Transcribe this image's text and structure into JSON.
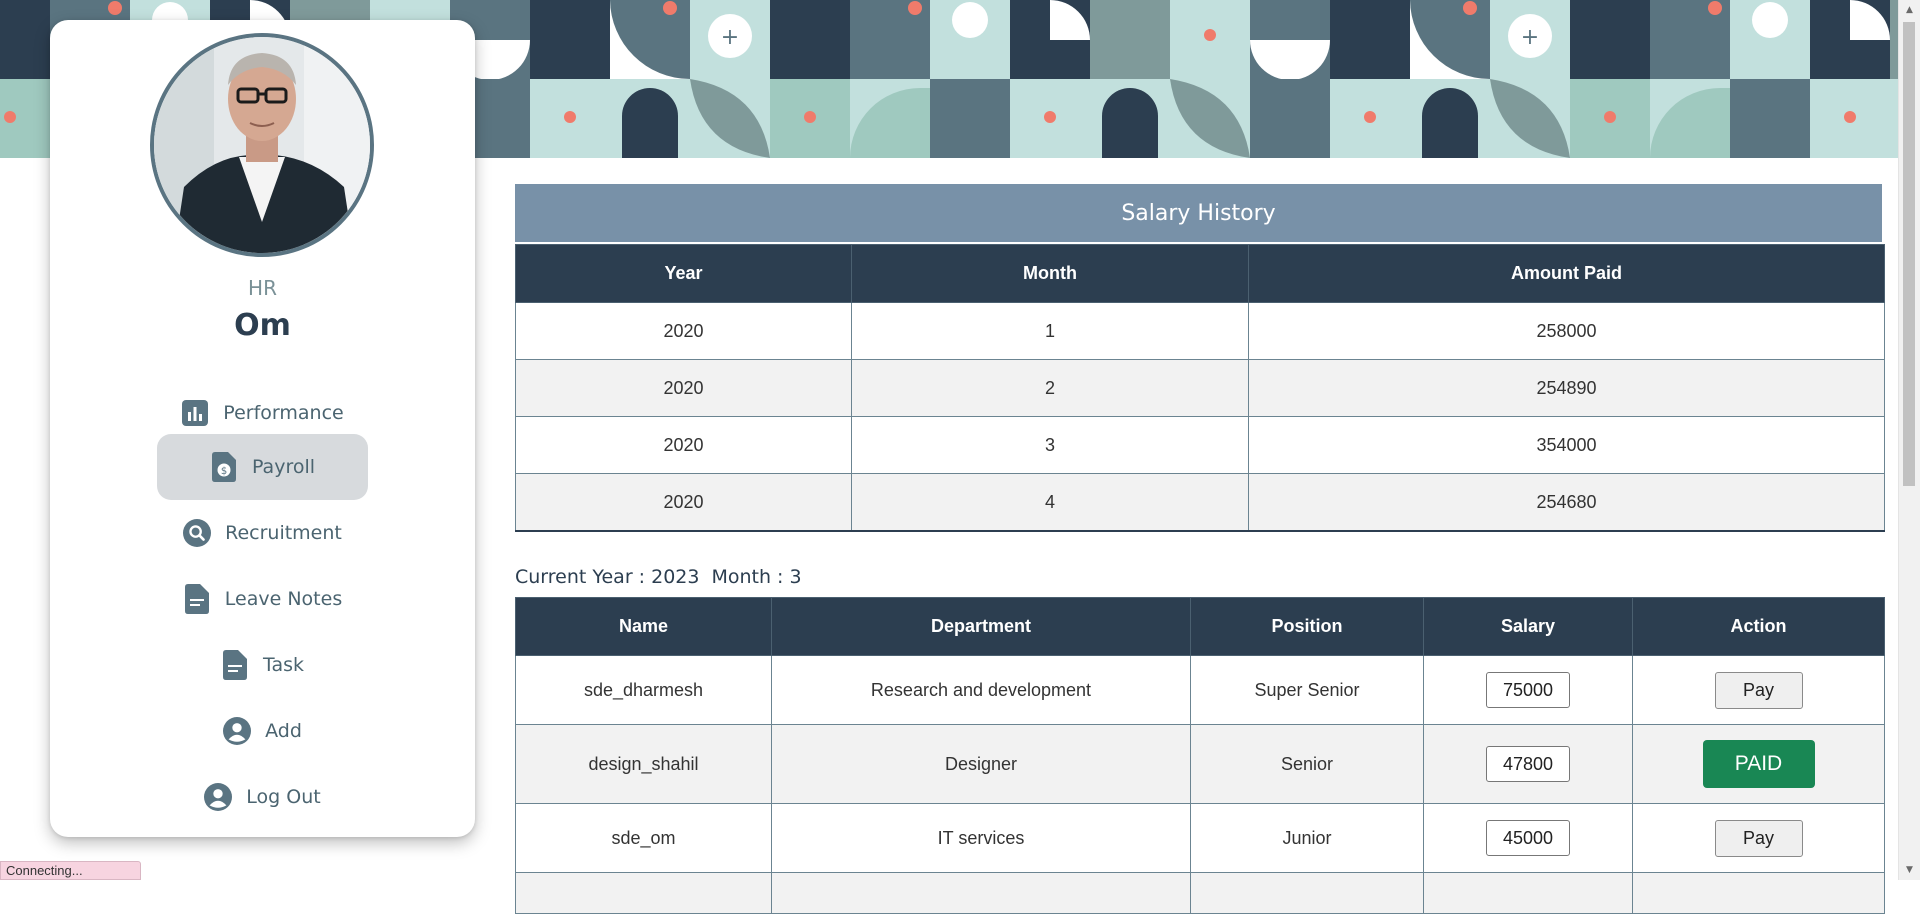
{
  "sidebar": {
    "role": "HR",
    "user_name": "Om",
    "items": [
      {
        "label": "Performance",
        "icon": "bar-chart-icon"
      },
      {
        "label": "Payroll",
        "icon": "payroll-icon",
        "active": true
      },
      {
        "label": "Recruitment",
        "icon": "search-icon"
      },
      {
        "label": "Leave Notes",
        "icon": "document-icon"
      },
      {
        "label": "Task",
        "icon": "document-icon"
      },
      {
        "label": "Add",
        "icon": "user-icon"
      },
      {
        "label": "Log Out",
        "icon": "user-icon"
      }
    ]
  },
  "salary_history": {
    "title": "Salary History",
    "columns": [
      "Year",
      "Month",
      "Amount Paid"
    ],
    "rows": [
      [
        "2020",
        "1",
        "258000"
      ],
      [
        "2020",
        "2",
        "254890"
      ],
      [
        "2020",
        "3",
        "354000"
      ],
      [
        "2020",
        "4",
        "254680"
      ]
    ]
  },
  "current": {
    "year_text": "Current Year : 2023",
    "month_text": "Month : 3"
  },
  "employees": {
    "columns": [
      "Name",
      "Department",
      "Position",
      "Salary",
      "Action"
    ],
    "rows": [
      {
        "name": "sde_dharmesh",
        "department": "Research and development",
        "position": "Super Senior",
        "salary": "75000",
        "action": "Pay"
      },
      {
        "name": "design_shahil",
        "department": "Designer",
        "position": "Senior",
        "salary": "47800",
        "action": "PAID"
      },
      {
        "name": "sde_om",
        "department": "IT services",
        "position": "Junior",
        "salary": "45000",
        "action": "Pay"
      }
    ]
  },
  "status_bar": {
    "text": "Connecting..."
  },
  "colors": {
    "table_header": "#2c3e50",
    "panel_title": "#7891a8",
    "paid_button": "#198754",
    "active_nav": "#d7dadd"
  }
}
